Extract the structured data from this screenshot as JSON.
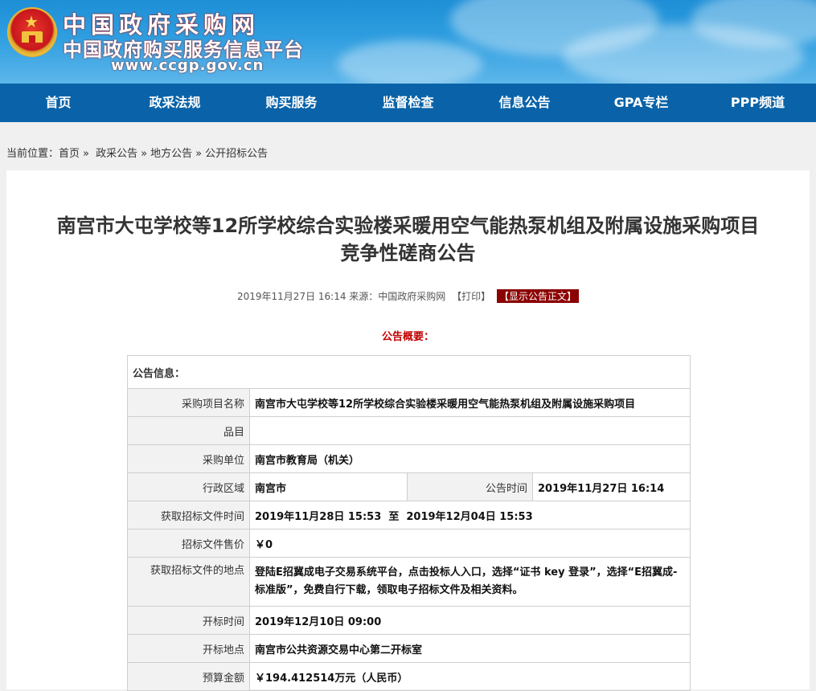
{
  "header": {
    "title": "中国政府采购网",
    "subtitle": "中国政府购买服务信息平台",
    "url": "www.ccgp.gov.cn",
    "emblem_icon": "national-emblem-icon"
  },
  "nav": {
    "items": [
      {
        "label": "首页"
      },
      {
        "label": "政采法规"
      },
      {
        "label": "购买服务"
      },
      {
        "label": "监督检查"
      },
      {
        "label": "信息公告"
      },
      {
        "label": "GPA专栏"
      },
      {
        "label": "PPP频道"
      }
    ]
  },
  "breadcrumb": {
    "prefix": "当前位置：",
    "items": [
      {
        "label": "首页"
      },
      {
        "label": "政采公告"
      },
      {
        "label": "地方公告"
      },
      {
        "label": "公开招标公告"
      }
    ],
    "separator": "»"
  },
  "article": {
    "title_line1": "南宫市大屯学校等12所学校综合实验楼采暖用空气能热泵机组及附属设施采购项目",
    "title_line2": "竞争性磋商公告",
    "meta_text": "2019年11月27日 16:14 来源：中国政府采购网",
    "print_label": "【打印】",
    "show_label": "【显示公告正文】",
    "summary_label": "公告概要："
  },
  "info": {
    "header": "公告信息：",
    "rows": [
      {
        "label": "采购项目名称",
        "value": "南宫市大屯学校等12所学校综合实验楼采暖用空气能热泵机组及附属设施采购项目"
      },
      {
        "label": "品目",
        "value": ""
      },
      {
        "label": "采购单位",
        "value": "南宫市教育局（机关）"
      },
      {
        "label": "行政区域",
        "value": "南宫市",
        "label2": "公告时间",
        "value2": "2019年11月27日 16:14"
      },
      {
        "label": "获取招标文件时间",
        "value": "2019年11月28日 15:53  至  2019年12月04日 15:53"
      },
      {
        "label": "招标文件售价",
        "value": "￥0"
      },
      {
        "label": "获取招标文件的地点",
        "value": "登陆E招冀成电子交易系统平台，点击投标人入口，选择“证书 key 登录”，选择“E招冀成-标准版”，免费自行下载，领取电子招标文件及相关资料。"
      },
      {
        "label": "开标时间",
        "value": "2019年12月10日 09:00"
      },
      {
        "label": "开标地点",
        "value": "南宫市公共资源交易中心第二开标室"
      },
      {
        "label": "预算金额",
        "value": "￥194.412514万元（人民币）"
      }
    ]
  }
}
